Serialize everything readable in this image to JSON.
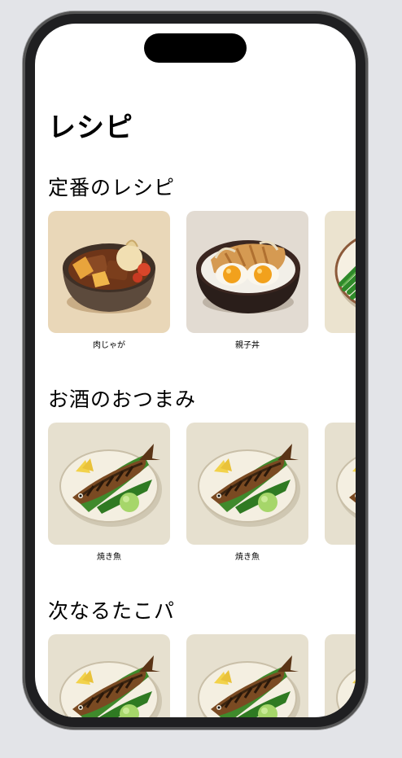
{
  "screen": {
    "title": "レシピ"
  },
  "sections": [
    {
      "title": "定番のレシピ",
      "items": [
        {
          "label": "肉じゃが",
          "image": "nikujaga-bowl"
        },
        {
          "label": "親子丼",
          "image": "oyakodon-bowl"
        },
        {
          "label": "",
          "image": "greens-plate"
        }
      ]
    },
    {
      "title": "お酒のおつまみ",
      "items": [
        {
          "label": "焼き魚",
          "image": "grilled-fish"
        },
        {
          "label": "焼き魚",
          "image": "grilled-fish"
        },
        {
          "label": "",
          "image": "grilled-fish"
        }
      ]
    },
    {
      "title": "次なるたこパ",
      "items": [
        {
          "label": "",
          "image": "grilled-fish"
        },
        {
          "label": "",
          "image": "grilled-fish"
        },
        {
          "label": "",
          "image": "grilled-fish"
        }
      ]
    }
  ],
  "colors": {
    "background": "#e3e4e8",
    "frame": "#1f1f21",
    "screen": "#ffffff",
    "text": "#000000"
  }
}
